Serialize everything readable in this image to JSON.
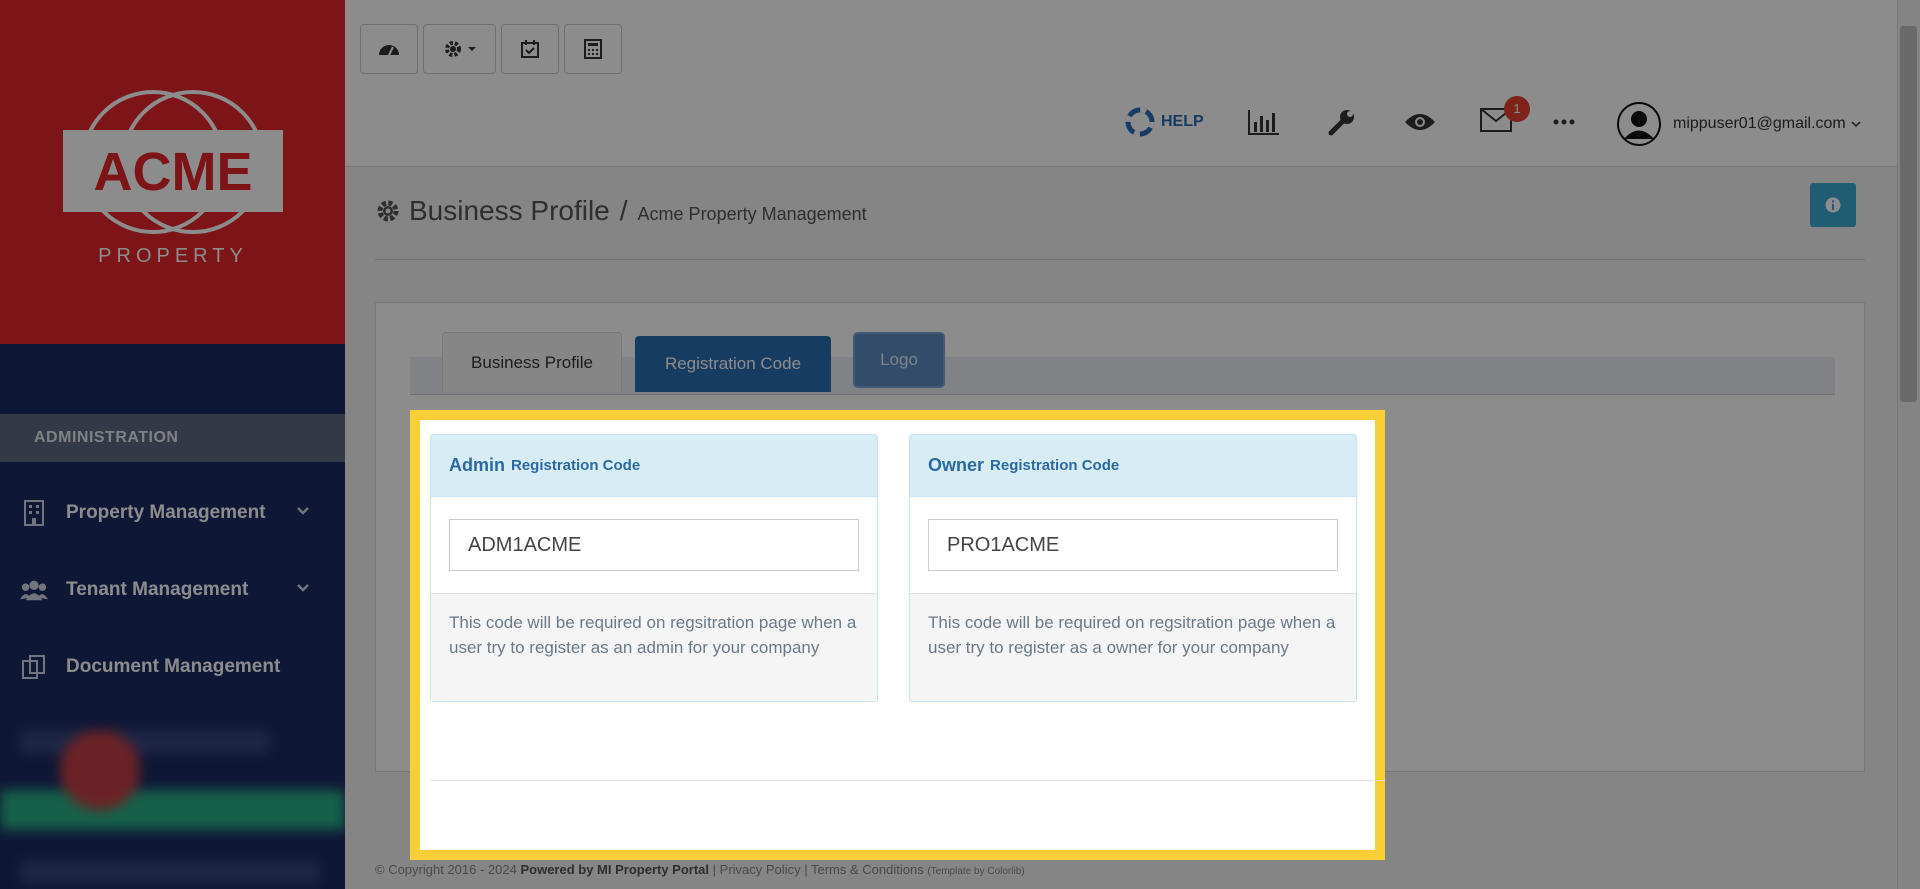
{
  "sidebar": {
    "brand": {
      "name": "ACME",
      "sub": "PROPERTY"
    },
    "section_label": "ADMINISTRATION",
    "items": [
      {
        "label": "Property Management",
        "icon": "building-icon"
      },
      {
        "label": "Tenant Management",
        "icon": "users-icon"
      },
      {
        "label": "Document Management",
        "icon": "documents-icon"
      }
    ]
  },
  "toolbar": {
    "buttons": [
      "dashboard-icon",
      "gear-dropdown-icon",
      "calendar-check-icon",
      "calculator-icon"
    ]
  },
  "header_nav": {
    "help_label": "HELP",
    "mail_badge": "1",
    "user_email": "mippuser01@gmail.com"
  },
  "page": {
    "title": "Business Profile",
    "separator": "/",
    "subtitle": "Acme Property Management"
  },
  "tabs": [
    {
      "label": "Business Profile",
      "active": false
    },
    {
      "label": "Registration Code",
      "active": true
    },
    {
      "label": "Logo",
      "active": false
    }
  ],
  "cards": {
    "admin": {
      "title_big": "Admin",
      "title_small": "Registration Code",
      "value": "ADM1ACME",
      "help": "This code will be required on regsitration page when a user try to register as an admin for your company"
    },
    "owner": {
      "title_big": "Owner",
      "title_small": "Registration Code",
      "value": "PRO1ACME",
      "help": "This code will be required on regsitration page when a user try to register as a owner for your company"
    }
  },
  "footer": {
    "copyright": "© Copyright 2016 - 2024",
    "powered": "Powered by MI Property Portal",
    "sep": "|",
    "privacy": "Privacy Policy",
    "terms": "Terms & Conditions",
    "template": "(Template by Colorlib)"
  },
  "colors": {
    "accent": "#2b6eb3",
    "highlight": "#f9cf35",
    "brand_red": "#e3262c",
    "sidebar": "#1b2a63"
  }
}
